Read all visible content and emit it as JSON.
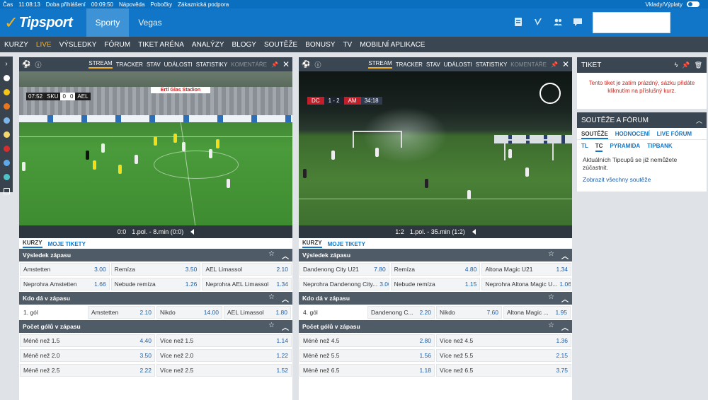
{
  "topbar": {
    "time_label": "Čas",
    "time": "11:08:13",
    "login_label": "Doba přihlášení",
    "login_time": "00:09:50",
    "help": "Nápověda",
    "branches": "Pobočky",
    "support": "Zákaznická podpora",
    "deposits": "Vklady/Výplaty"
  },
  "header": {
    "logo": "Tipsport",
    "tabs": [
      {
        "label": "Sporty",
        "active": true
      },
      {
        "label": "Vegas",
        "active": false
      }
    ]
  },
  "nav": [
    "KURZY",
    "LIVE",
    "VÝSLEDKY",
    "FÓRUM",
    "TIKET ARÉNA",
    "ANALÝZY",
    "BLOGY",
    "SOUTĚŽE",
    "BONUSY",
    "TV",
    "MOBILNÍ APLIKACE"
  ],
  "sidebar_icons": [
    {
      "name": "soccer-icon",
      "color": "#ffffff"
    },
    {
      "name": "tennis-icon",
      "color": "#f5c518"
    },
    {
      "name": "basketball-icon",
      "color": "#e8761c"
    },
    {
      "name": "hockey-icon",
      "color": "#7db6e8"
    },
    {
      "name": "volleyball-icon",
      "color": "#f5d76e"
    },
    {
      "name": "table-tennis-icon",
      "color": "#d62e2e"
    },
    {
      "name": "esports-icon",
      "color": "#5da9e9"
    },
    {
      "name": "handball-icon",
      "color": "#4dc3c9"
    },
    {
      "name": "calendar-icon",
      "color": "#ffffff"
    }
  ],
  "panels": [
    {
      "tabs": [
        {
          "label": "STREAM",
          "state": "on"
        },
        {
          "label": "TRACKER",
          "state": ""
        },
        {
          "label": "STAV",
          "state": ""
        },
        {
          "label": "UDÁLOSTI",
          "state": ""
        },
        {
          "label": "STATISTIKY",
          "state": ""
        },
        {
          "label": "KOMENTÁŘE",
          "state": "dim"
        }
      ],
      "scorebug": {
        "time": "07:52",
        "home": "SKU",
        "hs": "0",
        "as": "0",
        "away": "AEL"
      },
      "stadium_banner": "Ertl Glas Stadion",
      "video_status": {
        "score": "0:0",
        "period": "1.pol. - 8.min (0:0)"
      },
      "subtabs": [
        {
          "label": "KURZY",
          "on": true
        },
        {
          "label": "MOJE TIKETY",
          "on": false
        }
      ],
      "markets": [
        {
          "title": "Výsledek zápasu",
          "rows": [
            [
              {
                "n": "Amstetten",
                "o": "3.00"
              },
              {
                "n": "Remíza",
                "o": "3.50"
              },
              {
                "n": "AEL Limassol",
                "o": "2.10"
              }
            ],
            [
              {
                "n": "Neprohra Amstetten",
                "o": "1.66"
              },
              {
                "n": "Nebude remíza",
                "o": "1.26"
              },
              {
                "n": "Neprohra AEL Limassol",
                "o": "1.34"
              }
            ]
          ]
        },
        {
          "title": "Kdo dá v zápasu",
          "kdo": true,
          "rows": [
            [
              {
                "n": "1. gól",
                "o": ""
              },
              {
                "n": "Amstetten",
                "o": "2.10"
              },
              {
                "n": "Nikdo",
                "o": "14.00"
              },
              {
                "n": "AEL Limassol",
                "o": "1.80"
              }
            ]
          ]
        },
        {
          "title": "Počet gólů v zápasu",
          "rows": [
            [
              {
                "n": "Méně než 1.5",
                "o": "4.40"
              },
              {
                "n": "Více než 1.5",
                "o": "1.14"
              }
            ],
            [
              {
                "n": "Méně než 2.0",
                "o": "3.50"
              },
              {
                "n": "Více než 2.0",
                "o": "1.22"
              }
            ],
            [
              {
                "n": "Méně než 2.5",
                "o": "2.22"
              },
              {
                "n": "Více než 2.5",
                "o": "1.52"
              }
            ]
          ]
        }
      ]
    },
    {
      "tabs": [
        {
          "label": "STREAM",
          "state": "on"
        },
        {
          "label": "TRACKER",
          "state": ""
        },
        {
          "label": "STAV",
          "state": ""
        },
        {
          "label": "UDÁLOSTI",
          "state": ""
        },
        {
          "label": "STATISTIKY",
          "state": ""
        },
        {
          "label": "KOMENTÁŘE",
          "state": "dim"
        }
      ],
      "scorebug": {
        "home": "DC",
        "score": "1 - 2",
        "away": "AM",
        "time": "34:18"
      },
      "video_status": {
        "score": "1:2",
        "period": "1.pol. - 35.min (1:2)"
      },
      "subtabs": [
        {
          "label": "KURZY",
          "on": true
        },
        {
          "label": "MOJE TIKETY",
          "on": false
        }
      ],
      "markets": [
        {
          "title": "Výsledek zápasu",
          "rows": [
            [
              {
                "n": "Dandenong City U21",
                "o": "7.80"
              },
              {
                "n": "Remíza",
                "o": "4.80"
              },
              {
                "n": "Altona Magic U21",
                "o": "1.34"
              }
            ],
            [
              {
                "n": "Neprohra Dandenong City...",
                "o": "3.00"
              },
              {
                "n": "Nebude remíza",
                "o": "1.15"
              },
              {
                "n": "Neprohra Altona Magic U...",
                "o": "1.06"
              }
            ]
          ]
        },
        {
          "title": "Kdo dá v zápasu",
          "kdo": true,
          "rows": [
            [
              {
                "n": "4. gól",
                "o": ""
              },
              {
                "n": "Dandenong C...",
                "o": "2.20"
              },
              {
                "n": "Nikdo",
                "o": "7.60"
              },
              {
                "n": "Altona Magic ...",
                "o": "1.95"
              }
            ]
          ]
        },
        {
          "title": "Počet gólů v zápasu",
          "rows": [
            [
              {
                "n": "Méně než 4.5",
                "o": "2.80"
              },
              {
                "n": "Více než 4.5",
                "o": "1.36"
              }
            ],
            [
              {
                "n": "Méně než 5.5",
                "o": "1.56"
              },
              {
                "n": "Více než 5.5",
                "o": "2.15"
              }
            ],
            [
              {
                "n": "Méně než 6.5",
                "o": "1.18"
              },
              {
                "n": "Více než 6.5",
                "o": "3.75"
              }
            ]
          ]
        }
      ]
    }
  ],
  "ticket": {
    "title": "TIKET",
    "message": "Tento tiket je zatím prázdný, sázku přidáte kliknutím na příslušný kurz."
  },
  "contests": {
    "title": "SOUTĚŽE A FÓRUM",
    "tabs": [
      {
        "label": "SOUTĚŽE",
        "on": true
      },
      {
        "label": "HODNOCENÍ",
        "on": false
      },
      {
        "label": "LIVE FÓRUM",
        "on": false
      }
    ],
    "subtabs": [
      {
        "label": "TL",
        "on": false
      },
      {
        "label": "TC",
        "on": true
      },
      {
        "label": "PYRAMIDA",
        "on": false
      },
      {
        "label": "TIPBANK",
        "on": false
      }
    ],
    "body": "Aktuálních Tipcupů se již nemůžete zúčastnit.",
    "link": "Zobrazit všechny soutěže"
  }
}
